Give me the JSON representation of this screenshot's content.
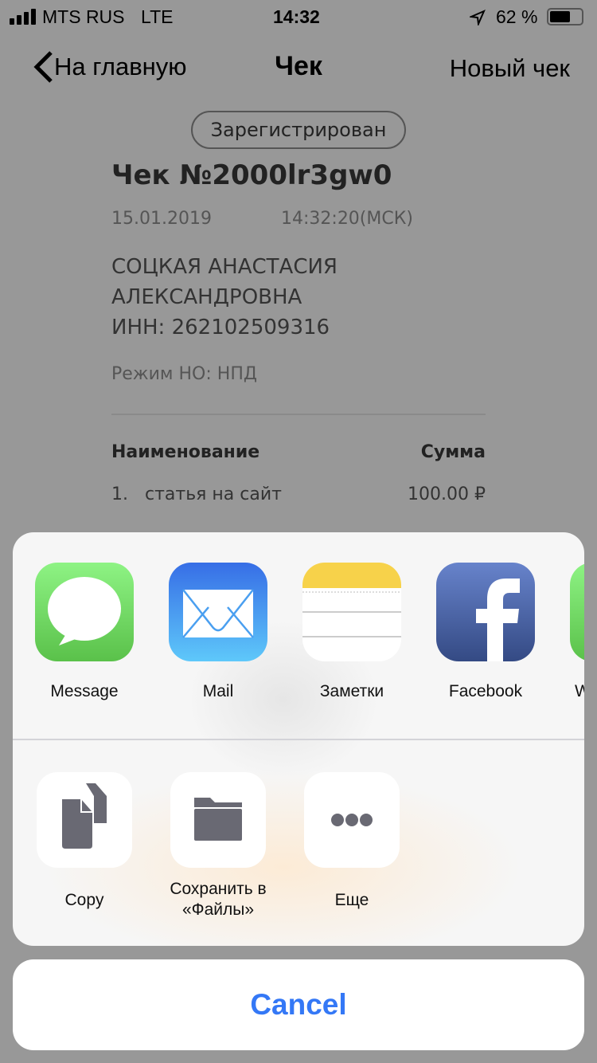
{
  "status_bar": {
    "carrier": "MTS RUS",
    "network": "LTE",
    "time": "14:32",
    "battery": "62 %",
    "battery_level": 62
  },
  "nav": {
    "back_label": "На главную",
    "title": "Чек",
    "right_label": "Новый чек"
  },
  "receipt": {
    "status": "Зарегистрирован",
    "title": "Чек №2000lr3gw0",
    "date": "15.01.2019",
    "time": "14:32:20(МСК)",
    "name_line1": "СОЦКАЯ АНАСТАСИЯ",
    "name_line2": "АЛЕКСАНДРОВНА",
    "inn": "ИНН: 262102509316",
    "tax_mode": "Режим НО: НПД",
    "col_name": "Наименование",
    "col_sum": "Сумма",
    "items": [
      {
        "num": "1.",
        "name": "статья на сайт",
        "sum": "100.00 ₽"
      }
    ]
  },
  "share": {
    "apps": [
      {
        "label": "Message",
        "icon": "messages-icon"
      },
      {
        "label": "Mail",
        "icon": "mail-icon"
      },
      {
        "label": "Заметки",
        "icon": "notes-icon"
      },
      {
        "label": "Facebook",
        "icon": "facebook-icon"
      },
      {
        "label": "W",
        "icon": "whatsapp-icon"
      }
    ],
    "actions": [
      {
        "label": "Copy",
        "icon": "copy-icon"
      },
      {
        "label_line1": "Сохранить в",
        "label_line2": "«Файлы»",
        "icon": "folder-icon"
      },
      {
        "label": "Еще",
        "icon": "more-icon"
      }
    ],
    "cancel": "Cancel"
  },
  "colors": {
    "accent": "#3478f6",
    "overlay": "#989898"
  }
}
